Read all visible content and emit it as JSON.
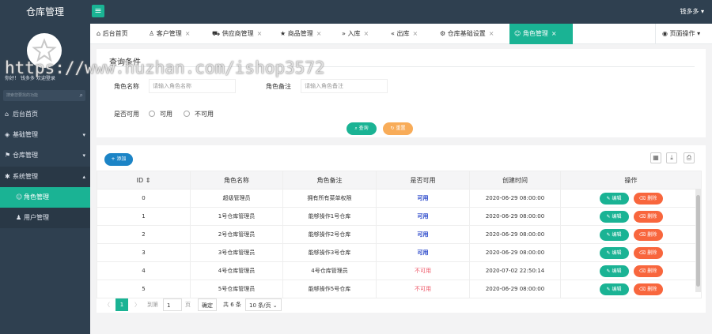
{
  "app": {
    "title": "仓库管理",
    "menu_icon": "hamburger-icon",
    "user_name": "钱多多",
    "user_caret": "▾"
  },
  "sidebar": {
    "welcome": "你好！ 钱多多 欢迎登录",
    "search_placeholder": "搜索您要找的功能",
    "items": [
      {
        "label": "后台首页",
        "icon": "home-icon"
      },
      {
        "label": "基础管理",
        "icon": "cube-icon",
        "caret": "▾"
      },
      {
        "label": "仓库管理",
        "icon": "truck-icon",
        "caret": "▾"
      },
      {
        "label": "系统管理",
        "icon": "gear-icon",
        "caret": "▴"
      },
      {
        "label": "角色管理",
        "icon": "smile-icon"
      },
      {
        "label": "用户管理",
        "icon": "user-icon"
      }
    ]
  },
  "tabs": [
    {
      "label": "后台首页",
      "icon": "home-icon",
      "close": ""
    },
    {
      "label": "客户管理",
      "icon": "user-icon",
      "close": "×"
    },
    {
      "label": "供应商管理",
      "icon": "cart-icon",
      "close": "×"
    },
    {
      "label": "商品管理",
      "icon": "star-icon",
      "close": "×"
    },
    {
      "label": "入库",
      "icon": "double-right-icon",
      "close": "×"
    },
    {
      "label": "出库",
      "icon": "double-left-icon",
      "close": "×"
    },
    {
      "label": "仓库基础设置",
      "icon": "gear-icon",
      "close": "×"
    },
    {
      "label": "角色管理",
      "icon": "smile-icon",
      "close": "×"
    }
  ],
  "page_op": {
    "label": "页面操作",
    "icon": "target-icon",
    "caret": "▾"
  },
  "query": {
    "title": "查询条件",
    "role_name_label": "角色名称",
    "role_name_placeholder": "请输入角色名称",
    "role_remark_label": "角色备注",
    "role_remark_placeholder": "请输入角色备注",
    "available_label": "是否可用",
    "radio_yes": "可用",
    "radio_no": "不可用",
    "search_btn": "查询",
    "reset_btn": "重置"
  },
  "watermark": "https://www.huzhan.com/ishop3572",
  "table": {
    "add_btn": "添加",
    "tools": [
      "grid-icon",
      "export-icon",
      "print-icon"
    ],
    "columns": [
      "ID",
      "角色名称",
      "角色备注",
      "是否可用",
      "创建时间",
      "操作"
    ],
    "sort_glyph": "⇕",
    "edit_label": "编辑",
    "delete_label": "删除",
    "rows": [
      {
        "id": "0",
        "name": "超级管理员",
        "remark": "拥有所有菜单权限",
        "available": "可用",
        "ok": true,
        "created": "2020-06-29 08:00:00"
      },
      {
        "id": "1",
        "name": "1号仓库管理员",
        "remark": "能够操作1号仓库",
        "available": "可用",
        "ok": true,
        "created": "2020-06-29 08:00:00"
      },
      {
        "id": "2",
        "name": "2号仓库管理员",
        "remark": "能够操作2号仓库",
        "available": "可用",
        "ok": true,
        "created": "2020-06-29 08:00:00"
      },
      {
        "id": "3",
        "name": "3号仓库管理员",
        "remark": "能够操作3号仓库",
        "available": "可用",
        "ok": true,
        "created": "2020-06-29 08:00:00"
      },
      {
        "id": "4",
        "name": "4号仓库管理员",
        "remark": "4号仓库管理员",
        "available": "不可用",
        "ok": false,
        "created": "2020-07-02 22:50:14"
      },
      {
        "id": "5",
        "name": "5号仓库管理员",
        "remark": "能够操作5号仓库",
        "available": "不可用",
        "ok": false,
        "created": "2020-06-29 08:00:00"
      }
    ]
  },
  "pager": {
    "prev": "〈",
    "current": "1",
    "next": "〉",
    "goto_label": "到第",
    "goto_value": "1",
    "page_unit": "页",
    "confirm": "确定",
    "total": "共 6 条",
    "page_size": "10 条/页"
  },
  "colors": {
    "sidebar": "#2f4050",
    "accent": "#1ab394",
    "blue": "#1c84c6",
    "orange": "#f8663d",
    "yellow": "#f8ac59"
  }
}
